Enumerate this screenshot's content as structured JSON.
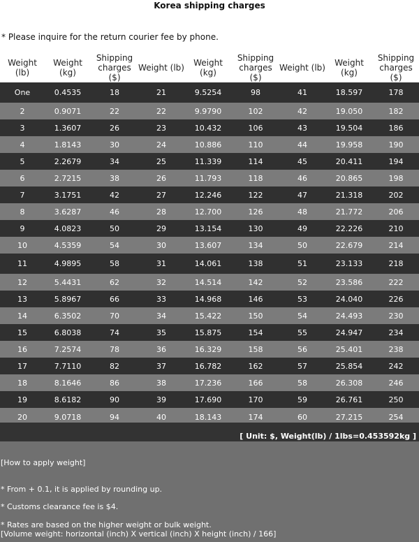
{
  "title": "Korea shipping charges",
  "note": "* Please inquire for the return courier fee by phone.",
  "headers": [
    "Weight (lb)",
    "Weight (kg)",
    "Shipping charges ($)",
    "Weight (lb)",
    "Weight (kg)",
    "Shipping charges ($)",
    "Weight (lb)",
    "Weight (kg)",
    "Shipping charges ($)"
  ],
  "rows": [
    [
      "One",
      "0.4535",
      "18",
      "21",
      "9.5254",
      "98",
      "41",
      "18.597",
      "178"
    ],
    [
      "2",
      "0.9071",
      "22",
      "22",
      "9.9790",
      "102",
      "42",
      "19.050",
      "182"
    ],
    [
      "3",
      "1.3607",
      "26",
      "23",
      "10.432",
      "106",
      "43",
      "19.504",
      "186"
    ],
    [
      "4",
      "1.8143",
      "30",
      "24",
      "10.886",
      "110",
      "44",
      "19.958",
      "190"
    ],
    [
      "5",
      "2.2679",
      "34",
      "25",
      "11.339",
      "114",
      "45",
      "20.411",
      "194"
    ],
    [
      "6",
      "2.7215",
      "38",
      "26",
      "11.793",
      "118",
      "46",
      "20.865",
      "198"
    ],
    [
      "7",
      "3.1751",
      "42",
      "27",
      "12.246",
      "122",
      "47",
      "21.318",
      "202"
    ],
    [
      "8",
      "3.6287",
      "46",
      "28",
      "12.700",
      "126",
      "48",
      "21.772",
      "206"
    ],
    [
      "9",
      "4.0823",
      "50",
      "29",
      "13.154",
      "130",
      "49",
      "22.226",
      "210"
    ],
    [
      "10",
      "4.5359",
      "54",
      "30",
      "13.607",
      "134",
      "50",
      "22.679",
      "214"
    ],
    [
      "11",
      "4.9895",
      "58",
      "31",
      "14.061",
      "138",
      "51",
      "23.133",
      "218"
    ],
    [
      "12",
      "5.4431",
      "62",
      "32",
      "14.514",
      "142",
      "52",
      "23.586",
      "222"
    ],
    [
      "13",
      "5.8967",
      "66",
      "33",
      "14.968",
      "146",
      "53",
      "24.040",
      "226"
    ],
    [
      "14",
      "6.3502",
      "70",
      "34",
      "15.422",
      "150",
      "54",
      "24.493",
      "230"
    ],
    [
      "15",
      "6.8038",
      "74",
      "35",
      "15.875",
      "154",
      "55",
      "24.947",
      "234"
    ],
    [
      "16",
      "7.2574",
      "78",
      "36",
      "16.329",
      "158",
      "56",
      "25.401",
      "238"
    ],
    [
      "17",
      "7.7110",
      "82",
      "37",
      "16.782",
      "162",
      "57",
      "25.854",
      "242"
    ],
    [
      "18",
      "8.1646",
      "86",
      "38",
      "17.236",
      "166",
      "58",
      "26.308",
      "246"
    ],
    [
      "19",
      "8.6182",
      "90",
      "39",
      "17.690",
      "170",
      "59",
      "26.761",
      "250"
    ],
    [
      "20",
      "9.0718",
      "94",
      "40",
      "18.143",
      "174",
      "60",
      "27.215",
      "254"
    ]
  ],
  "unit_text": "[ Unit: $, Weight(lb) / 1lbs=0.453592kg ]",
  "footer": {
    "heading": "[How to apply weight]",
    "rounding": "* From + 0.1, it is applied by rounding up.",
    "customs": "* Customs clearance fee is $4.",
    "rates": "* Rates are based on the higher weight or bulk weight.",
    "volume": "[Volume weight: horizontal (inch) X vertical (inch) X height (inch) / 166]"
  },
  "colors": {
    "row_dark": "#303030",
    "row_mid": "#7b7b7b",
    "footer_bg": "#707070",
    "unit_bar_bg": "#333333"
  }
}
